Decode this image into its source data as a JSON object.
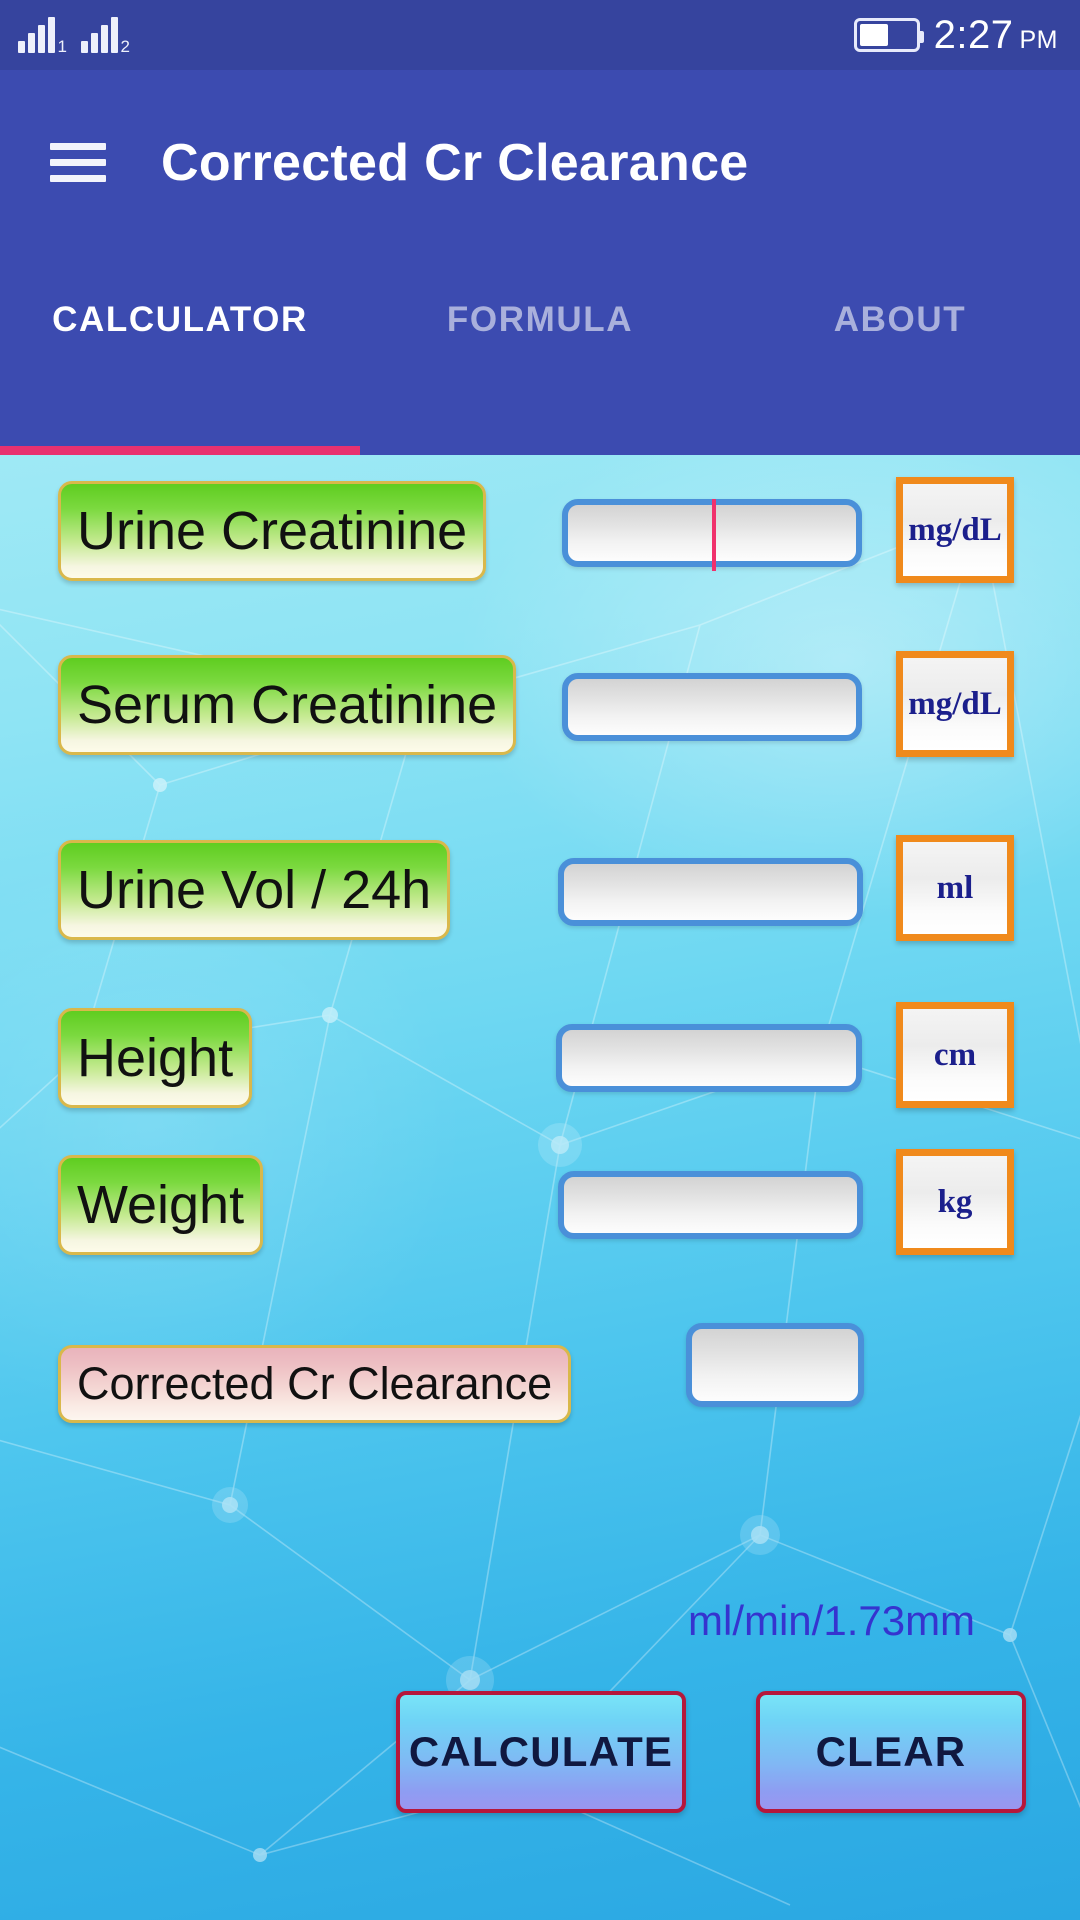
{
  "statusbar": {
    "time": "2:27",
    "ampm": "PM",
    "sim1_label": "1",
    "sim2_label": "2"
  },
  "appbar": {
    "title": "Corrected Cr Clearance",
    "menu_icon": "hamburger-menu-icon"
  },
  "tabs": [
    {
      "label": "CALCULATOR",
      "active": true
    },
    {
      "label": "FORMULA",
      "active": false
    },
    {
      "label": "ABOUT",
      "active": false
    }
  ],
  "colors": {
    "appbar": "#3c4bb0",
    "statusbar": "#36449e",
    "tab_indicator": "#e8316f",
    "label_border": "#d9b84b",
    "field_border": "#4a90d9",
    "unit_border": "#f08a1c",
    "unit_text": "#1b1f8c",
    "button_border": "#b5173b",
    "caret": "#f0316c",
    "result_unit_text": "#3534cf"
  },
  "form": {
    "rows": [
      {
        "label": "Urine Creatinine",
        "value": "",
        "unit": "mg/dL",
        "focused": true
      },
      {
        "label": "Serum Creatinine",
        "value": "",
        "unit": "mg/dL",
        "focused": false
      },
      {
        "label": "Urine Vol / 24h",
        "value": "",
        "unit": "ml",
        "focused": false
      },
      {
        "label": "Height",
        "value": "",
        "unit": "cm",
        "focused": false
      },
      {
        "label": "Weight",
        "value": "",
        "unit": "kg",
        "focused": false
      }
    ],
    "result": {
      "label": "Corrected Cr Clearance",
      "value": "",
      "unit": "ml/min/1.73mm"
    }
  },
  "actions": {
    "calculate": "CALCULATE",
    "clear": "CLEAR"
  }
}
